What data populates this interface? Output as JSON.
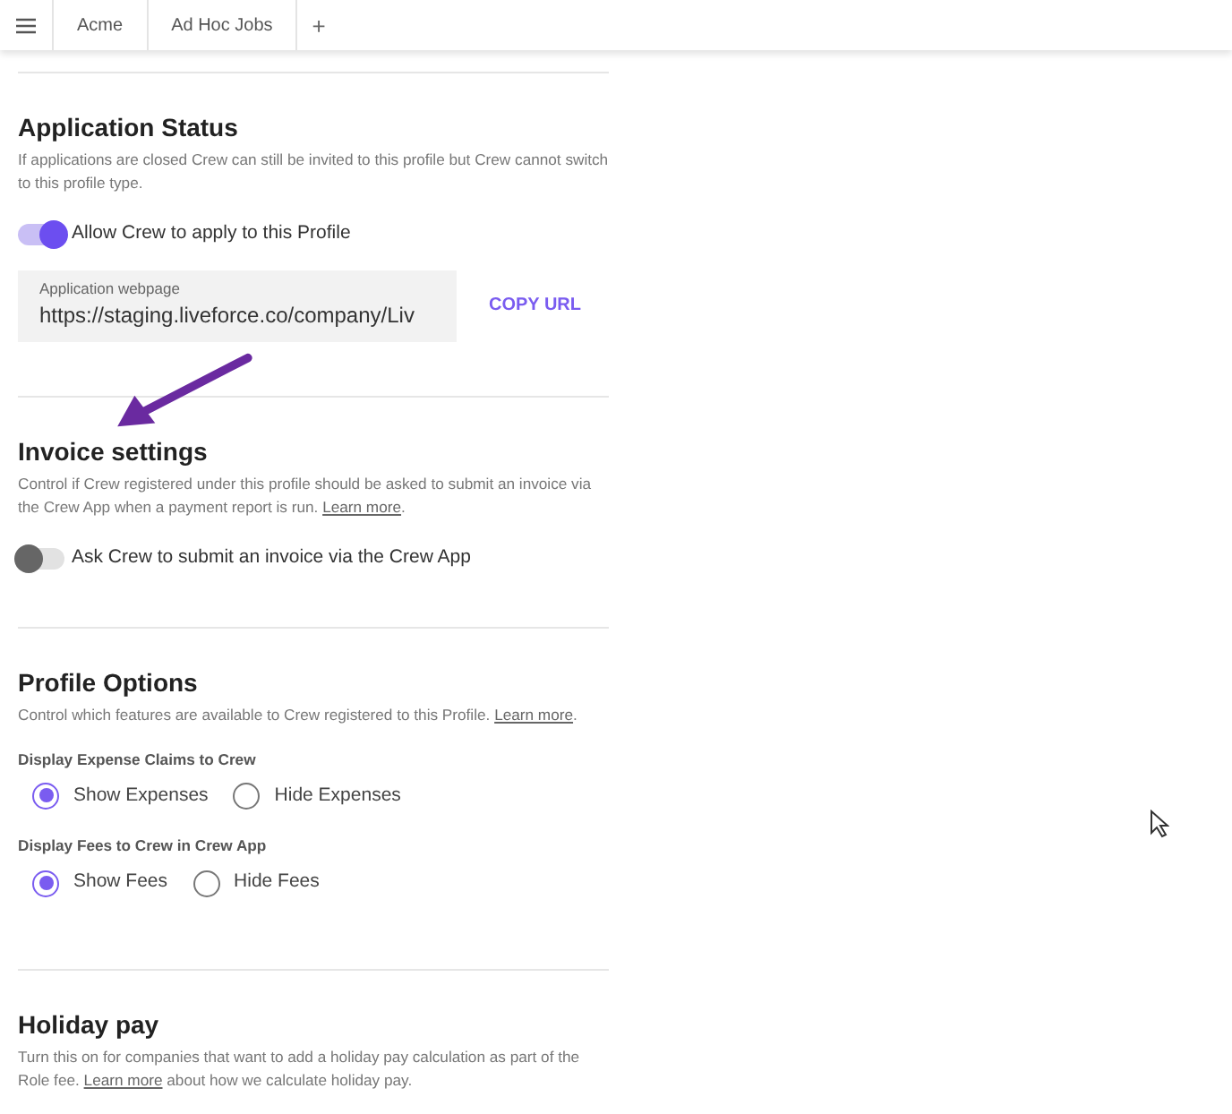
{
  "tabs": [
    {
      "label": "Acme",
      "selected": false
    },
    {
      "label": "Ad Hoc Jobs",
      "selected": false
    }
  ],
  "add_tab": "+",
  "sections": [
    {
      "title": "Application Status",
      "description": {
        "text": "If applications are closed Crew can still be invited to this profile but Crew cannot switch to this profile type."
      },
      "controls": [
        {
          "kind": "toggle",
          "label": "Allow Crew to apply to this Profile",
          "on": true
        },
        {
          "kind": "field",
          "label": "Application webpage",
          "value": "https://staging.liveforce.co/company/Liv",
          "action": "COPY URL"
        }
      ]
    },
    {
      "title": "Invoice settings",
      "description": {
        "text": "Control if Crew registered under this profile should be asked to submit an invoice via the Crew App when a payment report is run. ",
        "link": "Learn more",
        "after": "."
      },
      "controls": [
        {
          "kind": "toggle",
          "label": "Ask Crew to submit an invoice via the Crew App",
          "on": false
        }
      ]
    },
    {
      "title": "Profile Options",
      "description": {
        "text": "Control which features are available to Crew registered to this Profile. ",
        "link": "Learn more",
        "after": "."
      },
      "controls": [
        {
          "kind": "radio_group",
          "label": "Display Expense Claims to Crew",
          "options": [
            {
              "label": "Show Expenses",
              "selected": true
            },
            {
              "label": "Hide Expenses",
              "selected": false
            }
          ]
        },
        {
          "kind": "radio_group",
          "label": "Display Fees to Crew in Crew App",
          "options": [
            {
              "label": "Show Fees",
              "selected": true
            },
            {
              "label": "Hide Fees",
              "selected": false
            }
          ]
        }
      ]
    },
    {
      "title": "Holiday pay",
      "description": {
        "text": "Turn this on for companies that want to add a holiday pay calculation as part of the Role fee. ",
        "link": "Learn more",
        "after": " about how we calculate holiday pay."
      }
    }
  ]
}
